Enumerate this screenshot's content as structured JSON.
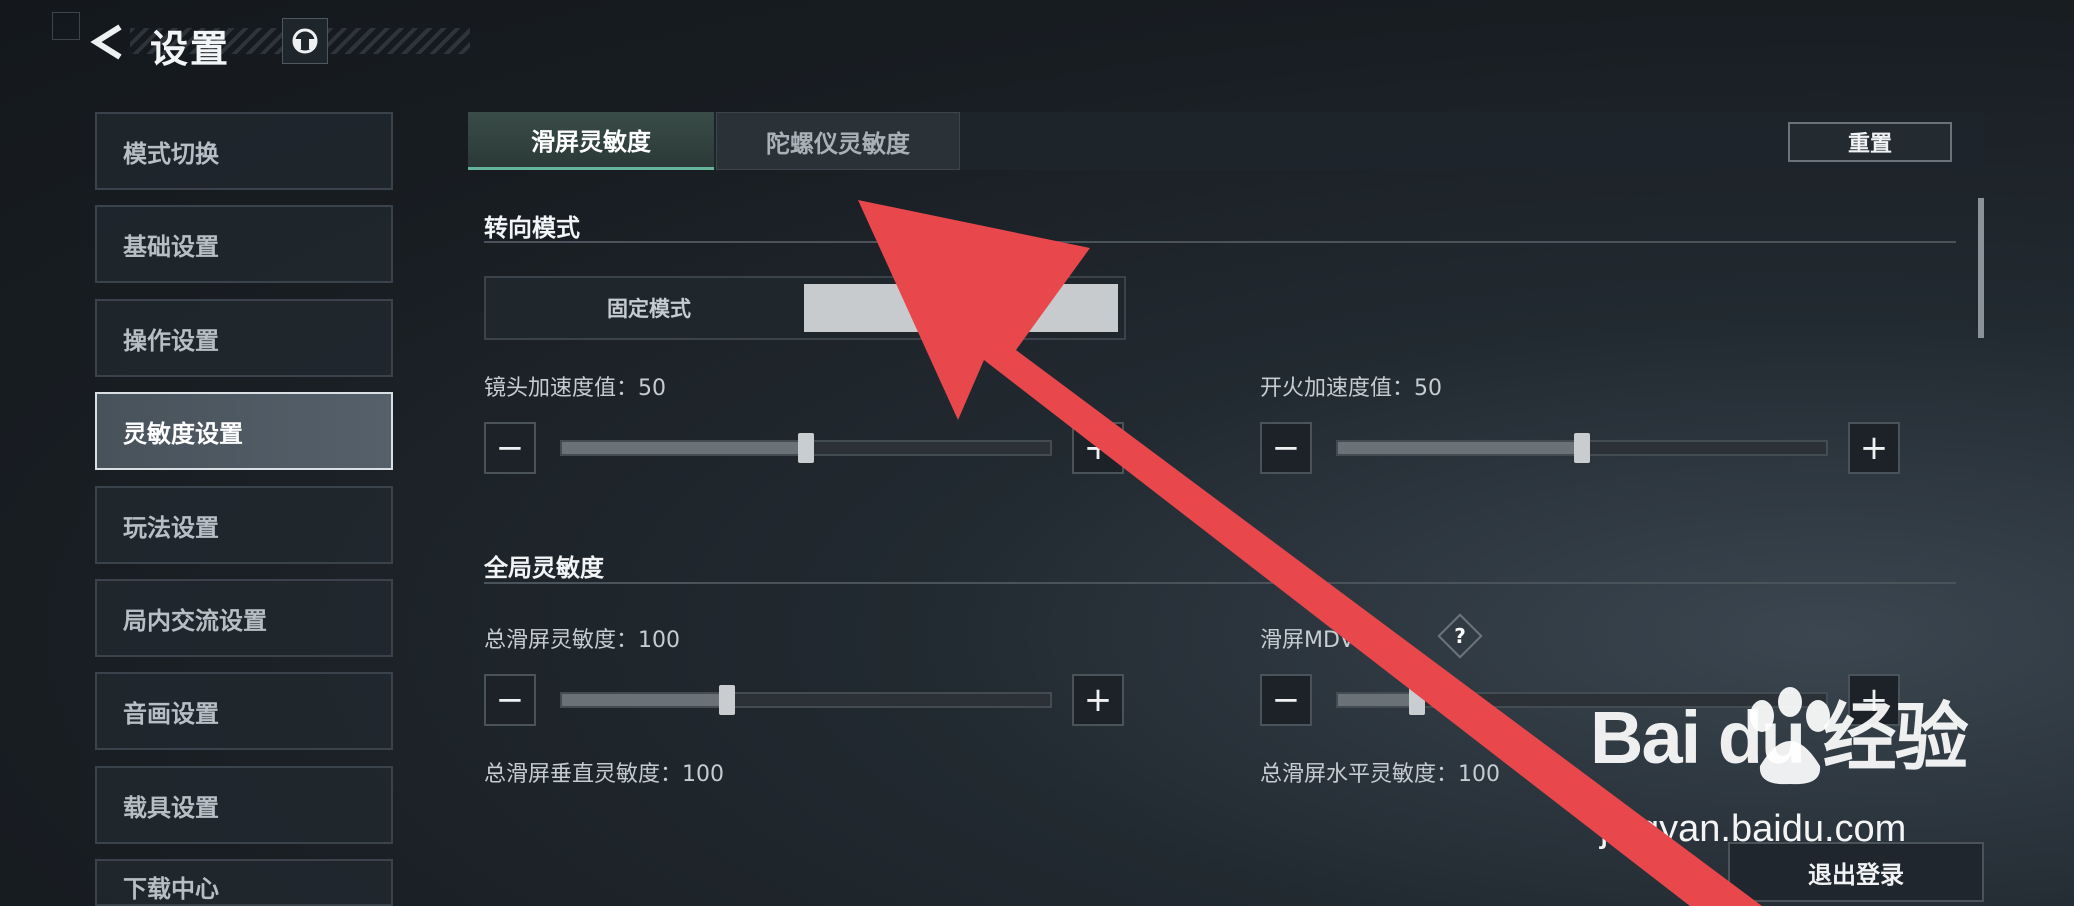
{
  "header": {
    "title": "设置"
  },
  "sidebar": {
    "items": [
      {
        "label": "模式切换"
      },
      {
        "label": "基础设置"
      },
      {
        "label": "操作设置"
      },
      {
        "label": "灵敏度设置",
        "active": true
      },
      {
        "label": "玩法设置"
      },
      {
        "label": "局内交流设置"
      },
      {
        "label": "音画设置"
      },
      {
        "label": "载具设置"
      },
      {
        "label": "下载中心"
      }
    ]
  },
  "tabs": [
    {
      "label": "滑屏灵敏度",
      "active": true
    },
    {
      "label": "陀螺仪灵敏度"
    }
  ],
  "reset_label": "重置",
  "sections": {
    "turn_mode": {
      "title": "转向模式",
      "options": [
        "固定模式",
        ""
      ]
    },
    "global": {
      "title": "全局灵敏度"
    }
  },
  "sliders": {
    "camera_accel": {
      "label": "镜头加速度值：50",
      "value": 50,
      "max": 100
    },
    "fire_accel": {
      "label": "开火加速度值：50",
      "value": 50,
      "max": 100
    },
    "total_swipe": {
      "label": "总滑屏灵敏度：100",
      "value": 100,
      "max": 300
    },
    "swipe_mdv": {
      "label": "滑屏MDV：",
      "fraction": 0.15
    },
    "vertical": {
      "label": "总滑屏垂直灵敏度：100"
    },
    "horizontal": {
      "label": "总滑屏水平灵敏度：100"
    }
  },
  "help_symbol": "?",
  "logout_label": "退出登录",
  "watermark": {
    "brand": "Bai du 经验",
    "url": "jingyan.baidu.com"
  },
  "annotation": {
    "arrow_color": "#e8474c"
  },
  "colors": {
    "accent": "#64b59a",
    "active_item": "#56606a"
  },
  "icons": {
    "back": "back-arrow-icon",
    "headset": "headset-icon",
    "minus": "minus-icon",
    "plus": "plus-icon"
  }
}
